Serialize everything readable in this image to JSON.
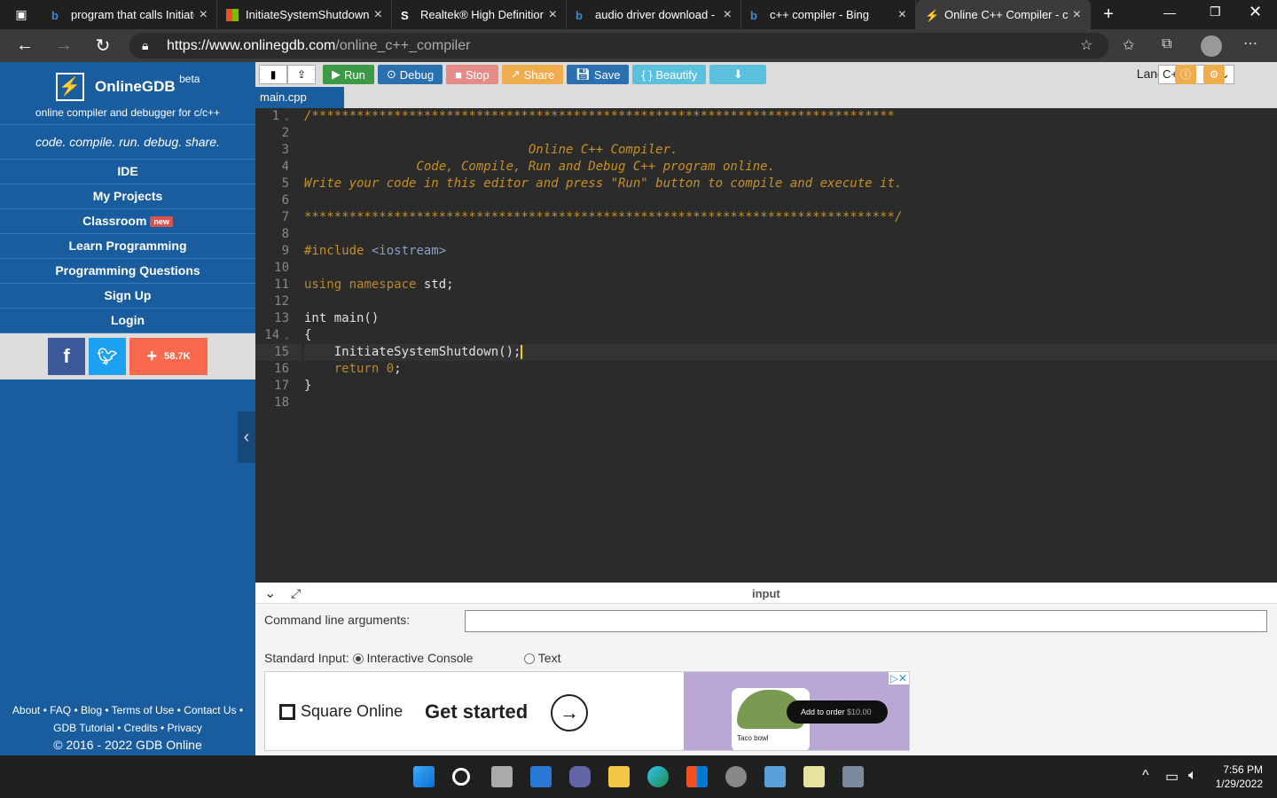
{
  "browser": {
    "tabs": [
      {
        "title": "program that calls InitiateSystemShutdown",
        "icon": "bing-icon",
        "active": false
      },
      {
        "title": "InitiateSystemShutdown",
        "icon": "microsoft-icon",
        "active": false
      },
      {
        "title": "Realtek® High Definition",
        "icon": "s-icon",
        "active": false
      },
      {
        "title": "audio driver download -",
        "icon": "bing-icon",
        "active": false
      },
      {
        "title": "c++ compiler - Bing",
        "icon": "bing-icon",
        "active": false
      },
      {
        "title": "Online C++ Compiler - c",
        "icon": "onlinegdb-icon",
        "active": true
      }
    ],
    "url_host": "https://www.onlinegdb.com",
    "url_path": "/online_c++_compiler"
  },
  "sidebar": {
    "brand": "OnlineGDB",
    "beta": "beta",
    "tagline": "online compiler and debugger for c/c++",
    "motto": "code. compile. run. debug. share.",
    "menu": [
      "IDE",
      "My Projects",
      "Classroom",
      "Learn Programming",
      "Programming Questions",
      "Sign Up",
      "Login"
    ],
    "new_badge": "new",
    "share_count": "58.7K",
    "footer_line1": "About • FAQ • Blog • Terms of Use • Contact Us •",
    "footer_line2": "GDB Tutorial • Credits • Privacy",
    "copyright": "© 2016 - 2022 GDB Online"
  },
  "toolbar": {
    "run": "Run",
    "debug": "Debug",
    "stop": "Stop",
    "share": "Share",
    "save": "Save",
    "beautify": "{ } Beautify",
    "language_label": "Language",
    "language_value": "C++",
    "colors": {
      "run": "#3c9a46",
      "debug": "#2a6fb0",
      "stop": "#d9534f",
      "share": "#f0ad4e",
      "save": "#2a6fb0",
      "beautify": "#5bc0de",
      "download": "#5bc0de"
    }
  },
  "editor": {
    "filename": "main.cpp",
    "current_line": 15
  },
  "io": {
    "title": "input",
    "cla_label": "Command line arguments:",
    "stdin_label": "Standard Input:",
    "opt_interactive": "Interactive Console",
    "opt_text": "Text"
  },
  "ad": {
    "brand": "Square Online",
    "cta": "Get started",
    "pill": "Add to order",
    "price": "$10.00",
    "item": "Taco bowl"
  },
  "taskbar": {
    "time": "7:56 PM",
    "date": "1/29/2022"
  }
}
